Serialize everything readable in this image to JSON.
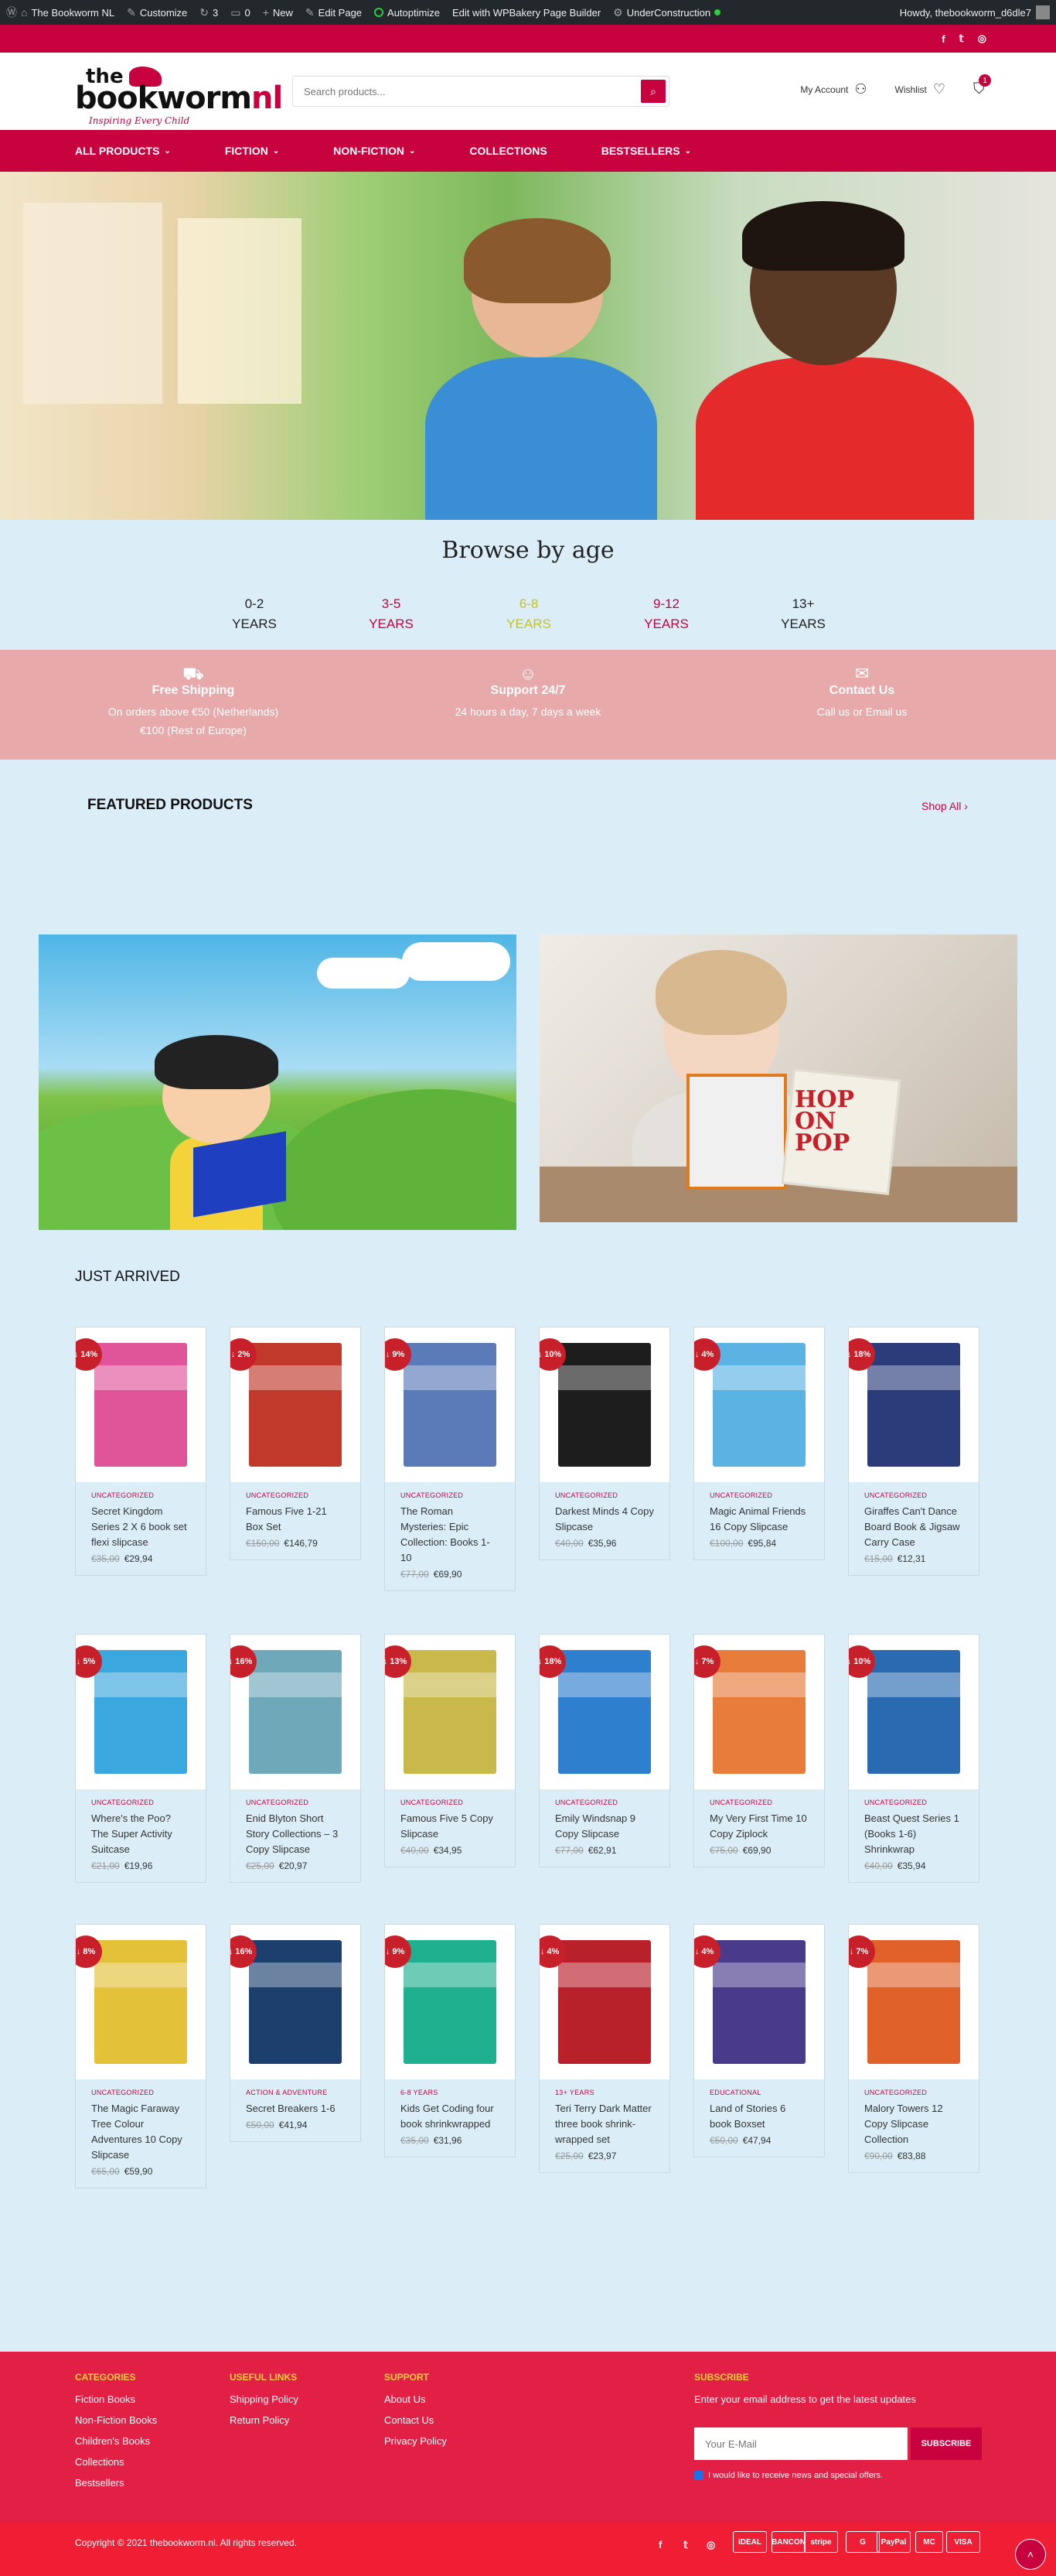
{
  "adminbar": {
    "site": "The Bookworm NL",
    "customize": "Customize",
    "updates": "3",
    "comments": "0",
    "new": "New",
    "edit_page": "Edit Page",
    "autoptimize": "Autoptimize",
    "wpbakery": "Edit with WPBakery Page Builder",
    "under_construction": "UnderConstruction",
    "howdy": "Howdy, thebookworm_d6dle7"
  },
  "header": {
    "logo_the": "the",
    "logo_main_a": "bookworm",
    "logo_main_b": "nl",
    "logo_tagline": "Inspiring Every Child",
    "search_placeholder": "Search products...",
    "my_account": "My Account",
    "wishlist": "Wishlist",
    "cart_count": "1"
  },
  "nav": {
    "items": [
      {
        "label": "ALL PRODUCTS",
        "dropdown": true
      },
      {
        "label": "FICTION",
        "dropdown": true
      },
      {
        "label": "NON-FICTION",
        "dropdown": true
      },
      {
        "label": "COLLECTIONS",
        "dropdown": false
      },
      {
        "label": "BESTSELLERS",
        "dropdown": true
      }
    ]
  },
  "browse": {
    "title": "Browse by age",
    "ages": [
      {
        "range": "0-2",
        "unit": "YEARS",
        "color": "#222222"
      },
      {
        "range": "3-5",
        "unit": "YEARS",
        "color": "#c8013f"
      },
      {
        "range": "6-8",
        "unit": "YEARS",
        "color": "#c9c21a"
      },
      {
        "range": "9-12",
        "unit": "YEARS",
        "color": "#c8013f"
      },
      {
        "range": "13+",
        "unit": "YEARS",
        "color": "#222222"
      }
    ]
  },
  "infobar": {
    "shipping_title": "Free Shipping",
    "shipping_line1": "On orders above €50 (Netherlands)",
    "shipping_line2": "€100 (Rest of Europe)",
    "support_title": "Support 24/7",
    "support_line1": "24 hours a day, 7 days a week",
    "contact_title": "Contact Us",
    "contact_line1": "Call us or Email us"
  },
  "featured": {
    "title": "FEATURED PRODUCTS",
    "shop_all": "Shop All",
    "banner2_book": "HOP ON POP"
  },
  "just_arrived": {
    "title": "JUST ARRIVED",
    "products": [
      {
        "discount": "↓ 14%",
        "category": "UNCATEGORIZED",
        "name": "Secret Kingdom Series 2 X 6 book set flexi slipcase",
        "old": "€35,00",
        "price": "€29,94",
        "color": "#e0559a"
      },
      {
        "discount": "↓ 2%",
        "category": "UNCATEGORIZED",
        "name": "Famous Five 1-21 Box Set",
        "old": "€150,00",
        "price": "€146,79",
        "color": "#c0392b"
      },
      {
        "discount": "↓ 9%",
        "category": "UNCATEGORIZED",
        "name": "The Roman Mysteries: Epic Collection: Books 1-10",
        "old": "€77,00",
        "price": "€69,90",
        "color": "#5a7ab8"
      },
      {
        "discount": "↓ 10%",
        "category": "UNCATEGORIZED",
        "name": "Darkest Minds 4 Copy Slipcase",
        "old": "€40,00",
        "price": "€35,96",
        "color": "#1d1d1d"
      },
      {
        "discount": "↓ 4%",
        "category": "UNCATEGORIZED",
        "name": "Magic Animal Friends 16 Copy Slipcase",
        "old": "€100,00",
        "price": "€95,84",
        "color": "#5bb3e3"
      },
      {
        "discount": "↓ 18%",
        "category": "UNCATEGORIZED",
        "name": "Giraffes Can't Dance Board Book & Jigsaw Carry Case",
        "old": "€15,00",
        "price": "€12,31",
        "color": "#2a3d7a"
      },
      {
        "discount": "↓ 5%",
        "category": "UNCATEGORIZED",
        "name": "Where's the Poo? The Super Activity Suitcase",
        "old": "€21,00",
        "price": "€19,96",
        "color": "#3ba7df"
      },
      {
        "discount": "↓ 16%",
        "category": "UNCATEGORIZED",
        "name": "Enid Blyton Short Story Collections – 3 Copy Slipcase",
        "old": "€25,00",
        "price": "€20,97",
        "color": "#6fa8b8"
      },
      {
        "discount": "↓ 13%",
        "category": "UNCATEGORIZED",
        "name": "Famous Five 5 Copy Slipcase",
        "old": "€40,00",
        "price": "€34,95",
        "color": "#c9b84a"
      },
      {
        "discount": "↓ 18%",
        "category": "UNCATEGORIZED",
        "name": "Emily Windsnap 9 Copy Slipcase",
        "old": "€77,00",
        "price": "€62,91",
        "color": "#2f7fcf"
      },
      {
        "discount": "↓ 7%",
        "category": "UNCATEGORIZED",
        "name": "My Very First Time 10 Copy Ziplock",
        "old": "€75,00",
        "price": "€69,90",
        "color": "#e87c3a"
      },
      {
        "discount": "↓ 10%",
        "category": "UNCATEGORIZED",
        "name": "Beast Quest Series 1 (Books 1-6) Shrinkwrap",
        "old": "€40,00",
        "price": "€35,94",
        "color": "#2a6ab0"
      },
      {
        "discount": "↓ 8%",
        "category": "UNCATEGORIZED",
        "name": "The Magic Faraway Tree Colour Adventures 10 Copy Slipcase",
        "old": "€65,00",
        "price": "€59,90",
        "color": "#e3c23a"
      },
      {
        "discount": "↓ 16%",
        "category": "ACTION & ADVENTURE",
        "name": "Secret Breakers 1-6",
        "old": "€50,00",
        "price": "€41,94",
        "color": "#1d3f6e"
      },
      {
        "discount": "↓ 9%",
        "category": "6-8 YEARS",
        "name": "Kids Get Coding four book shrinkwrapped",
        "old": "€35,00",
        "price": "€31,96",
        "color": "#1fb08f"
      },
      {
        "discount": "↓ 4%",
        "category": "13+ YEARS",
        "name": "Teri Terry Dark Matter three book shrink-wrapped set",
        "old": "€25,00",
        "price": "€23,97",
        "color": "#b8202a"
      },
      {
        "discount": "↓ 4%",
        "category": "EDUCATIONAL",
        "name": "Land of Stories 6 book Boxset",
        "old": "€50,00",
        "price": "€47,94",
        "color": "#4a3a8a"
      },
      {
        "discount": "↓ 7%",
        "category": "UNCATEGORIZED",
        "name": "Malory Towers 12 Copy Slipcase Collection",
        "old": "€90,00",
        "price": "€83,88",
        "color": "#e0622a"
      }
    ]
  },
  "footer": {
    "categories_title": "CATEGORIES",
    "categories": [
      "Fiction Books",
      "Non-Fiction Books",
      "Children's Books",
      "Collections",
      "Bestsellers"
    ],
    "useful_title": "USEFUL LINKS",
    "useful": [
      "Shipping Policy",
      "Return Policy"
    ],
    "support_title": "SUPPORT",
    "support": [
      "About Us",
      "Contact Us",
      "Privacy Policy"
    ],
    "subscribe_title": "SUBSCRIBE",
    "subscribe_text": "Enter your email address to get the latest updates",
    "email_placeholder": "Your E-Mail",
    "subscribe_button": "SUBSCRIBE",
    "consent": "I would like to receive news and special offers."
  },
  "bottom": {
    "copyright": "Copyright © 2021 thebookworm.nl. All rights reserved.",
    "payments": [
      "iDEAL",
      "BANCON",
      "stripe",
      "G",
      "PayPal",
      "MC",
      "VISA"
    ]
  }
}
